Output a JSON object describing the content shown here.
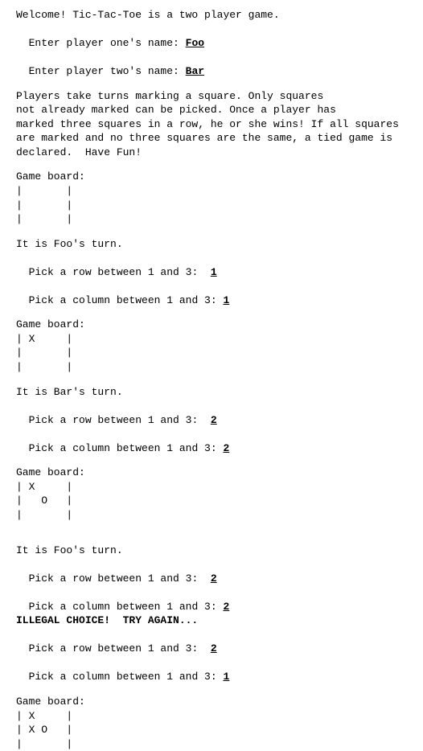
{
  "intro": {
    "welcome": "Welcome! Tic-Tac-Toe is a two player game.",
    "prompt_p1": "Enter player one's name: ",
    "name_p1": "Foo",
    "prompt_p2": "Enter player two's name: ",
    "name_p2": "Bar"
  },
  "rules": {
    "l1": "Players take turns marking a square. Only squares",
    "l2": "not already marked can be picked. Once a player has",
    "l3": "marked three squares in a row, he or she wins! If all squares",
    "l4": "are marked and no three squares are the same, a tied game is",
    "l5": "declared.  Have Fun!"
  },
  "labels": {
    "board_header": "Game board:",
    "row_prompt": "Pick a row between 1 and 3:  ",
    "col_prompt": "Pick a column between 1 and 3: ",
    "illegal": "ILLEGAL CHOICE!  TRY AGAIN..."
  },
  "turns": {
    "t1": {
      "announce": "It is Foo's turn.",
      "row": "1",
      "col": "1"
    },
    "t2": {
      "announce": "It is Bar's turn.",
      "row": "2",
      "col": "2"
    },
    "t3": {
      "announce": "It is Foo's turn.",
      "bad_row": "2",
      "bad_col": "2",
      "row": "2",
      "col": "1"
    }
  },
  "boards": {
    "b0": {
      "r1": "|       |",
      "r2": "|       |",
      "r3": "|       |"
    },
    "b1": {
      "r1": "| X     |",
      "r2": "|       |",
      "r3": "|       |"
    },
    "b2": {
      "r1": "| X     |",
      "r2": "|   O   |",
      "r3": "|       |"
    },
    "b3": {
      "r1": "| X     |",
      "r2": "| X O   |",
      "r3": "|       |"
    }
  }
}
